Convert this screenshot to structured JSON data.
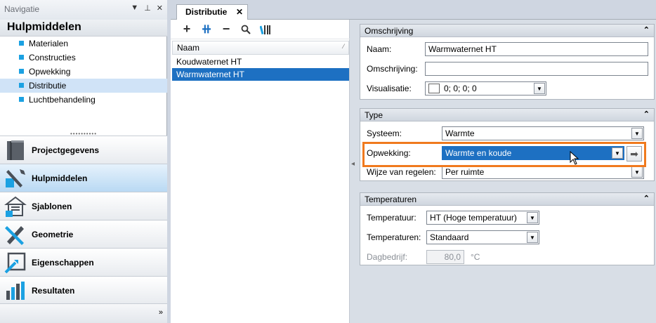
{
  "nav": {
    "title": "Navigatie",
    "header": "Hulpmiddelen",
    "items": [
      {
        "label": "Materialen",
        "active": false
      },
      {
        "label": "Constructies",
        "active": false
      },
      {
        "label": "Opwekking",
        "active": false
      },
      {
        "label": "Distributie",
        "active": true
      },
      {
        "label": "Luchtbehandeling",
        "active": false
      }
    ],
    "buttons": [
      {
        "label": "Projectgegevens",
        "icon": "project-icon"
      },
      {
        "label": "Hulpmiddelen",
        "icon": "tools-icon"
      },
      {
        "label": "Sjablonen",
        "icon": "template-icon"
      },
      {
        "label": "Geometrie",
        "icon": "geometry-icon"
      },
      {
        "label": "Eigenschappen",
        "icon": "properties-icon"
      },
      {
        "label": "Resultaten",
        "icon": "results-icon"
      }
    ],
    "more": "»"
  },
  "tab": {
    "label": "Distributie"
  },
  "list": {
    "column": "Naam",
    "rows": [
      {
        "label": "Koudwaternet HT",
        "selected": false
      },
      {
        "label": "Warmwaternet HT",
        "selected": true
      }
    ]
  },
  "groups": {
    "omschrijving": {
      "title": "Omschrijving",
      "naam_label": "Naam:",
      "naam_value": "Warmwaternet HT",
      "omschrijving_label": "Omschrijving:",
      "omschrijving_value": "",
      "visualisatie_label": "Visualisatie:",
      "visualisatie_value": "0; 0; 0; 0"
    },
    "type": {
      "title": "Type",
      "systeem_label": "Systeem:",
      "systeem_value": "Warmte",
      "opwekking_label": "Opwekking:",
      "opwekking_value": "Warmte en koude",
      "regelen_label": "Wijze van regelen:",
      "regelen_value": "Per ruimte"
    },
    "temperaturen": {
      "title": "Temperaturen",
      "temp_label": "Temperatuur:",
      "temp_value": "HT (Hoge temperatuur)",
      "temps_label": "Temperaturen:",
      "temps_value": "Standaard",
      "dag_label": "Dagbedrijf:",
      "dag_value": "80,0",
      "dag_unit": "°C"
    }
  },
  "colors": {
    "accent": "#1ba1e2",
    "selection": "#1d70c2",
    "highlight": "#f07a1e"
  }
}
